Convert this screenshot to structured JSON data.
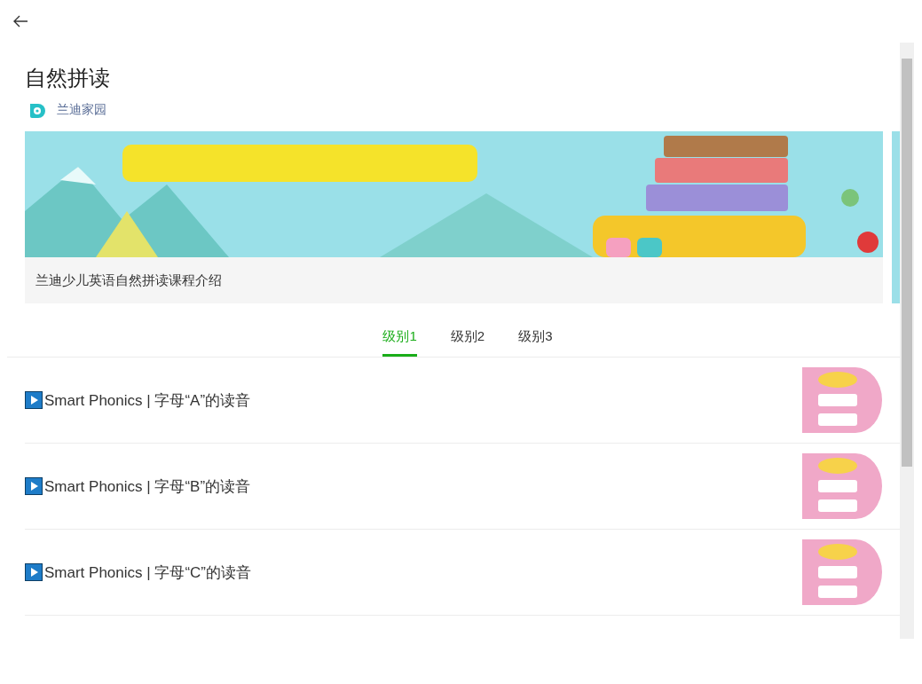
{
  "page": {
    "title": "自然拼读",
    "source": "兰迪家园"
  },
  "banner": {
    "caption": "兰迪少儿英语自然拼读课程介绍"
  },
  "tabs": [
    {
      "label": "级别1",
      "selected": true
    },
    {
      "label": "级别2",
      "selected": false
    },
    {
      "label": "级别3",
      "selected": false
    }
  ],
  "lessons": [
    {
      "title": "Smart Phonics | 字母“A”的读音"
    },
    {
      "title": "Smart Phonics | 字母“B”的读音"
    },
    {
      "title": "Smart Phonics | 字母“C”的读音"
    }
  ]
}
